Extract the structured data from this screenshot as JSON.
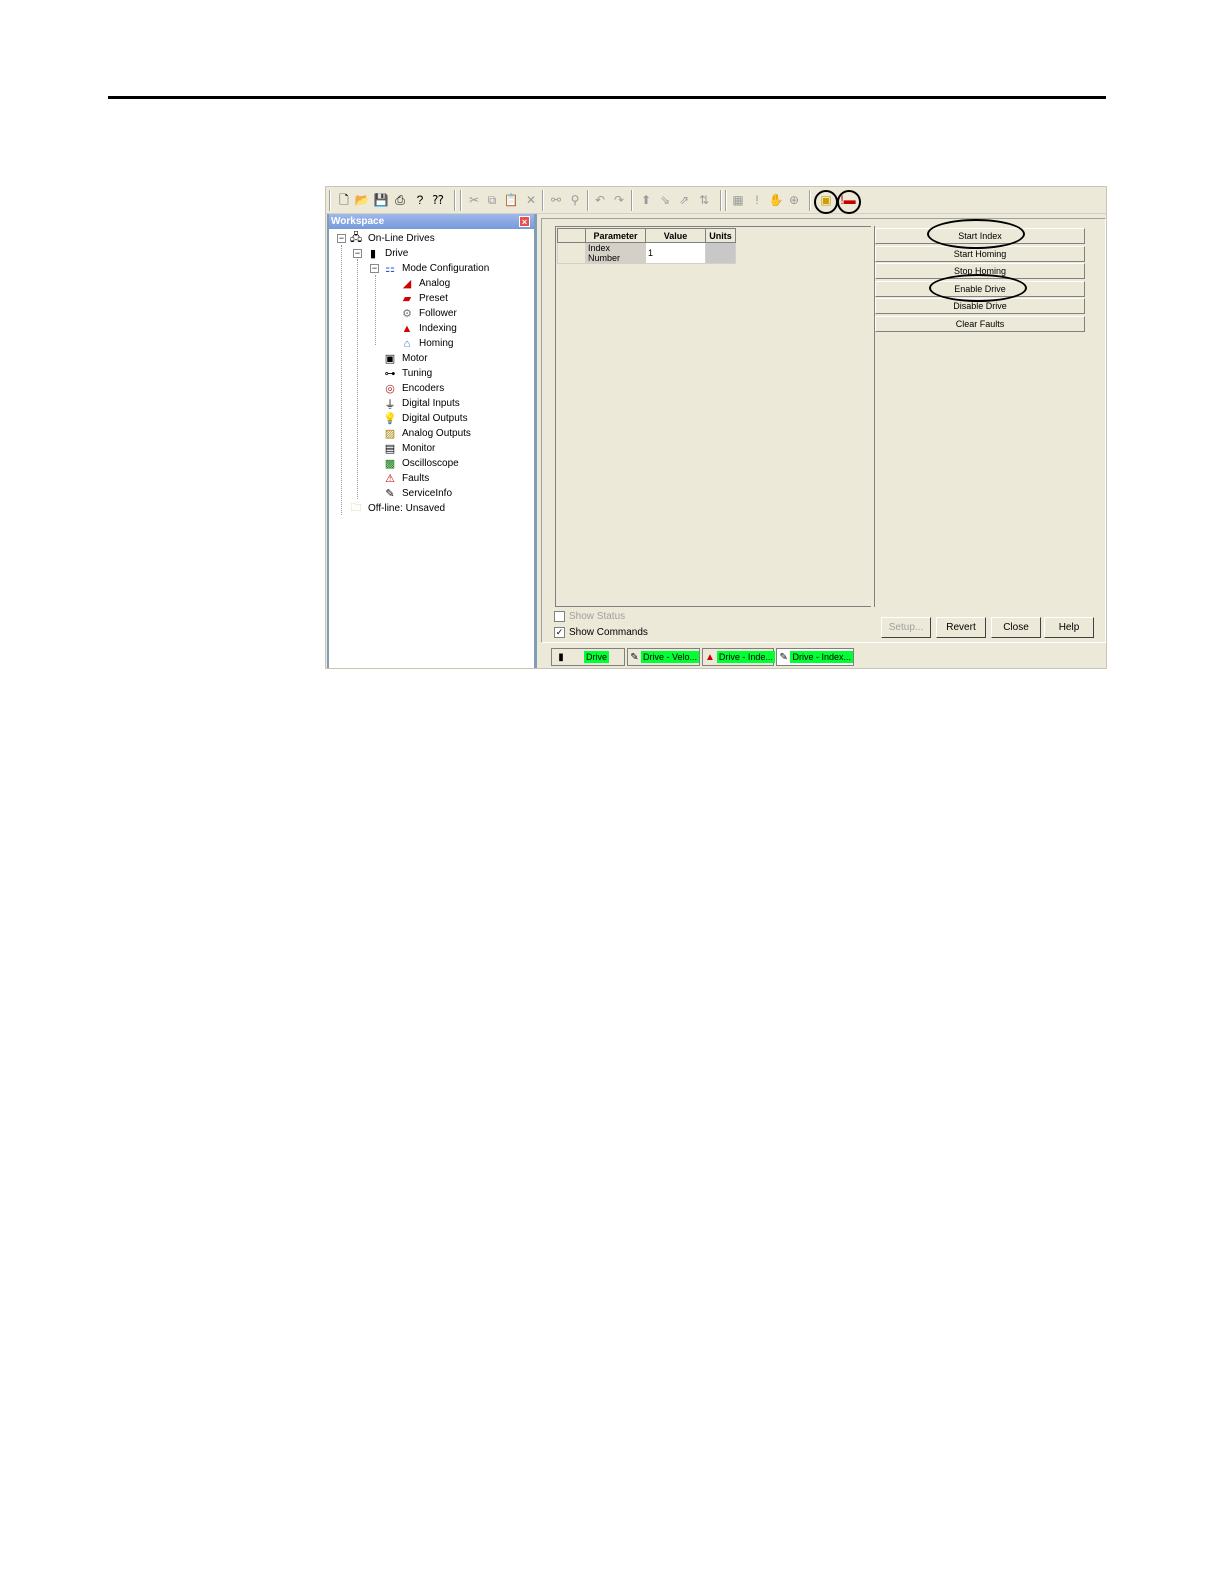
{
  "toolbar": {
    "buttons": [
      "new-icon",
      "open-icon",
      "save-icon",
      "print-icon",
      "help-icon",
      "context-help-icon",
      "cut-icon",
      "copy-icon",
      "paste-icon",
      "delete-icon",
      "find-icon",
      "replace-icon",
      "undo-icon",
      "redo-icon",
      "upload-icon",
      "download-icon",
      "verify-icon",
      "compare-icon",
      "properties-icon",
      "warning-icon",
      "hand-icon",
      "globe-icon",
      "show-status-icon",
      "show-commands-icon"
    ]
  },
  "workspace": {
    "title": "Workspace",
    "tree": [
      {
        "label": "On-Line Drives",
        "icon": "computer-icon"
      },
      {
        "label": "Drive",
        "icon": "drive-icon"
      },
      {
        "label": "Mode Configuration",
        "icon": "mode-config-icon"
      },
      {
        "label": "Analog",
        "icon": "analog-icon"
      },
      {
        "label": "Preset",
        "icon": "preset-icon"
      },
      {
        "label": "Follower",
        "icon": "follower-icon"
      },
      {
        "label": "Indexing",
        "icon": "indexing-icon"
      },
      {
        "label": "Homing",
        "icon": "homing-icon"
      },
      {
        "label": "Motor",
        "icon": "motor-icon"
      },
      {
        "label": "Tuning",
        "icon": "tuning-icon"
      },
      {
        "label": "Encoders",
        "icon": "encoders-icon"
      },
      {
        "label": "Digital Inputs",
        "icon": "digital-inputs-icon"
      },
      {
        "label": "Digital Outputs",
        "icon": "digital-outputs-icon"
      },
      {
        "label": "Analog Outputs",
        "icon": "analog-outputs-icon"
      },
      {
        "label": "Monitor",
        "icon": "monitor-icon"
      },
      {
        "label": "Oscilloscope",
        "icon": "oscilloscope-icon"
      },
      {
        "label": "Faults",
        "icon": "faults-icon"
      },
      {
        "label": "ServiceInfo",
        "icon": "service-info-icon"
      },
      {
        "label": "Off-line: Unsaved",
        "icon": "folder-icon"
      }
    ]
  },
  "grid": {
    "headers": [
      "Parameter",
      "Value",
      "Units"
    ],
    "rows": [
      {
        "parameter": "Index Number",
        "value": "1",
        "units": ""
      }
    ]
  },
  "commands": [
    "Start Index",
    "Start Homing",
    "Stop Homing",
    "Enable Drive",
    "Disable Drive",
    "Clear Faults"
  ],
  "checkboxes": {
    "show_status": {
      "label": "Show Status",
      "checked": false,
      "enabled": false
    },
    "show_commands": {
      "label": "Show Commands",
      "checked": true,
      "enabled": true
    }
  },
  "buttons": {
    "setup": "Setup...",
    "revert": "Revert",
    "close": "Close",
    "help": "Help"
  },
  "tabs": [
    {
      "label": "Drive",
      "icon": "drive-icon"
    },
    {
      "label": "Drive - Velo...",
      "icon": "velocity-icon"
    },
    {
      "label": "Drive - Inde...",
      "icon": "indexing-icon"
    },
    {
      "label": "Drive - Index...",
      "icon": "velocity-icon"
    }
  ],
  "colors": {
    "status_green": "#00ff33",
    "panel": "#ece9d8"
  }
}
